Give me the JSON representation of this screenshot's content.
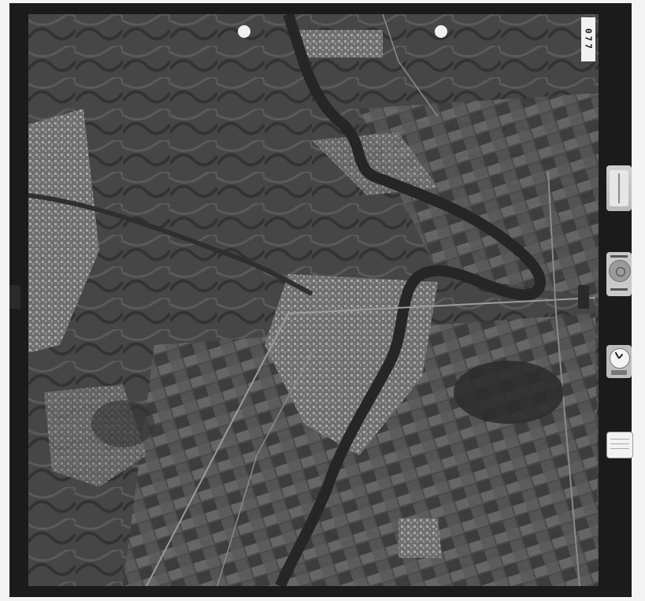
{
  "image": {
    "kind": "aerial-photograph",
    "tone": "grayscale",
    "frame_number": "077",
    "colors": {
      "film_border": "#1b1b1b",
      "paper": "#f4f4f4",
      "river": "#2c2c2c",
      "urban": "#8e8e8e",
      "fields_light": "#7a7a7a",
      "fields_dark": "#3a3a3a"
    }
  },
  "instruments": {
    "altimeter": "altimeter-icon",
    "level": "level-bubble-icon",
    "clock": "clock-icon",
    "data_card": "data-card-icon"
  }
}
